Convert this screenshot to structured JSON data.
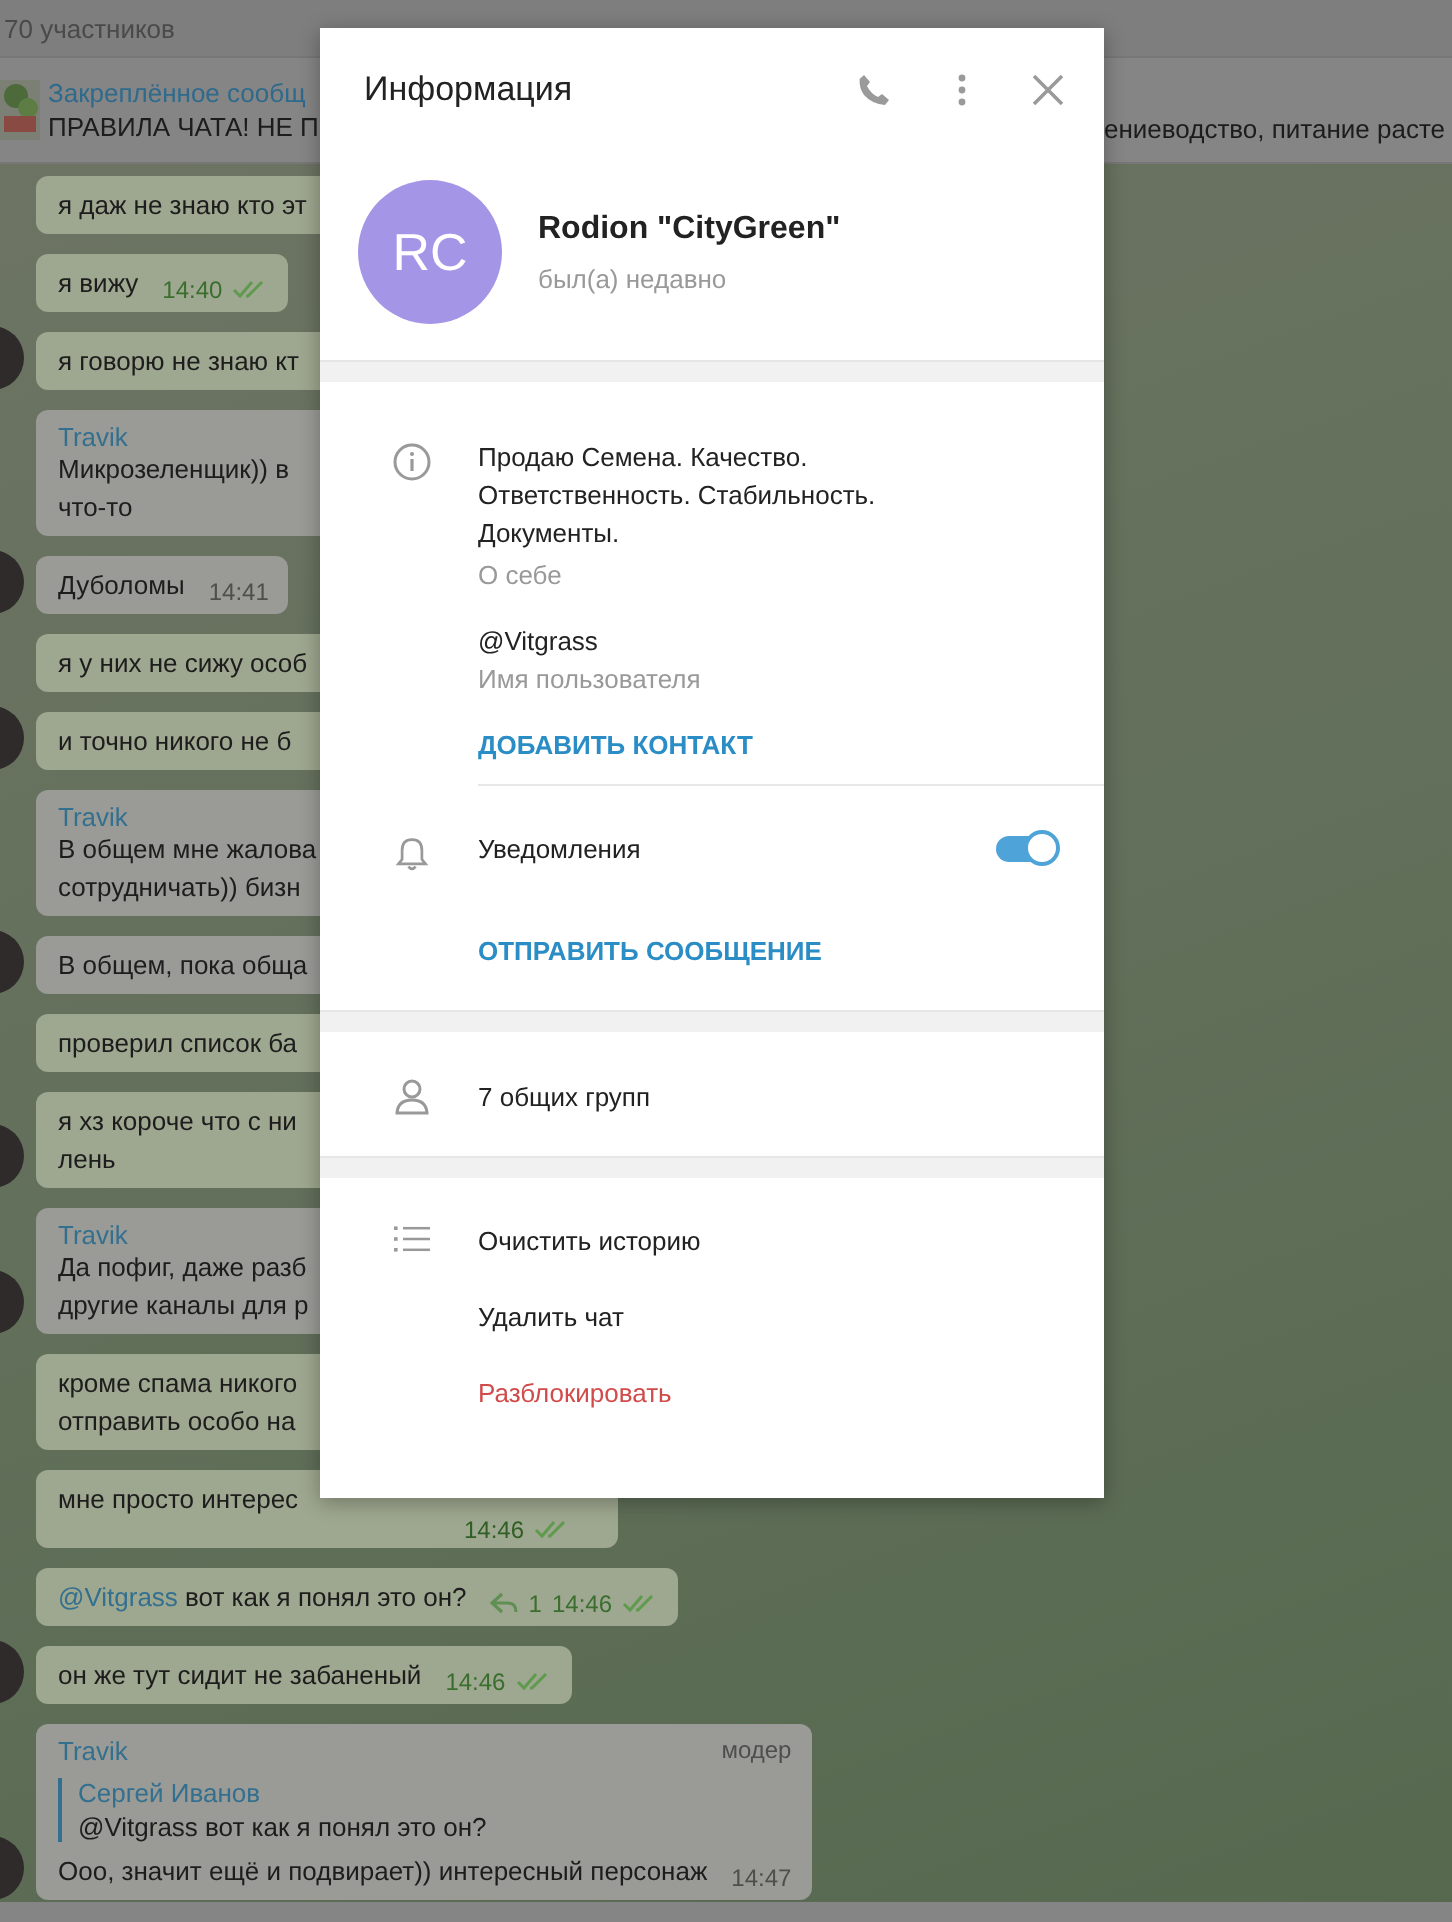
{
  "chat": {
    "members": "70 участников",
    "pinned": {
      "label": "Закреплённое сообщ",
      "text_left": "ПРАВИЛА ЧАТА! НЕ П",
      "text_right": "ениеводство, питание расте"
    },
    "messages": [
      {
        "kind": "outgoing",
        "lines": [
          "я даж не знаю кто эт"
        ],
        "covered": true
      },
      {
        "kind": "outgoing",
        "lines": [
          "я вижу"
        ],
        "time": "14:40",
        "read": true
      },
      {
        "kind": "outgoing",
        "lines": [
          "я говорю не знаю кт"
        ],
        "covered": true,
        "avatar": true
      },
      {
        "kind": "incoming",
        "author": "Travik",
        "lines": [
          "Микрозеленщик)) в",
          "что-то"
        ],
        "covered": true
      },
      {
        "kind": "incoming",
        "lines": [
          "Дуболомы"
        ],
        "time": "14:41",
        "avatar": true
      },
      {
        "kind": "outgoing",
        "lines": [
          "я у них не сижу особ"
        ],
        "covered": true
      },
      {
        "kind": "outgoing",
        "lines": [
          "и точно никого не б"
        ],
        "covered": true,
        "avatar": true
      },
      {
        "kind": "incoming",
        "author": "Travik",
        "lines": [
          "В общем мне жалова",
          "сотрудничать)) бизн"
        ],
        "covered": true
      },
      {
        "kind": "incoming",
        "lines": [
          "В общем, пока обща"
        ],
        "covered": true,
        "avatar": true
      },
      {
        "kind": "outgoing",
        "lines": [
          "проверил список ба"
        ],
        "covered": true
      },
      {
        "kind": "outgoing",
        "lines": [
          "я хз короче что с ни",
          "лень"
        ],
        "covered": true,
        "avatar": true
      },
      {
        "kind": "incoming",
        "author": "Travik",
        "lines": [
          "Да пофиг, даже разб",
          "другие каналы для р"
        ],
        "covered": true,
        "avatar": true
      },
      {
        "kind": "outgoing",
        "lines": [
          "кроме спама никого",
          "отправить особо на"
        ],
        "covered": true
      },
      {
        "kind": "outgoing",
        "lines": [
          "мне просто интерес"
        ],
        "covered": true,
        "time": "14:46",
        "read": true
      },
      {
        "kind": "outgoing",
        "mention": "@Vitgrass",
        "lines": [
          "вот как я понял это он?"
        ],
        "replies": "1",
        "time": "14:46",
        "read": true
      },
      {
        "kind": "outgoing",
        "lines": [
          "он же тут сидит не забаненый"
        ],
        "time": "14:46",
        "read": true,
        "avatar": true
      },
      {
        "kind": "incoming",
        "author": "Travik",
        "badge": "модер",
        "quote": {
          "author": "Сергей Иванов",
          "text": "@Vitgrass вот как я понял это он?"
        },
        "lines": [
          "Ооо, значит ещё и подвирает)) интересный персонаж"
        ],
        "time": "14:47",
        "avatar": true
      }
    ]
  },
  "dialog": {
    "title": "Информация",
    "profile": {
      "initials": "RC",
      "name": "Rodion \"CityGreen\"",
      "status": "был(а) недавно"
    },
    "about": {
      "text": "Продаю Семена. Качество.\nОтветственность. Стабильность.\nДокументы.",
      "caption": "О себе"
    },
    "username": {
      "value": "@Vitgrass",
      "caption": "Имя пользователя"
    },
    "add_contact": "ДОБАВИТЬ КОНТАКТ",
    "notifications": {
      "label": "Уведомления",
      "on": true
    },
    "send_message": "ОТПРАВИТЬ СООБЩЕНИЕ",
    "groups": "7 общих групп",
    "actions": [
      {
        "label": "Очистить историю",
        "kind": "normal"
      },
      {
        "label": "Удалить чат",
        "kind": "normal"
      },
      {
        "label": "Разблокировать",
        "kind": "danger"
      }
    ]
  }
}
